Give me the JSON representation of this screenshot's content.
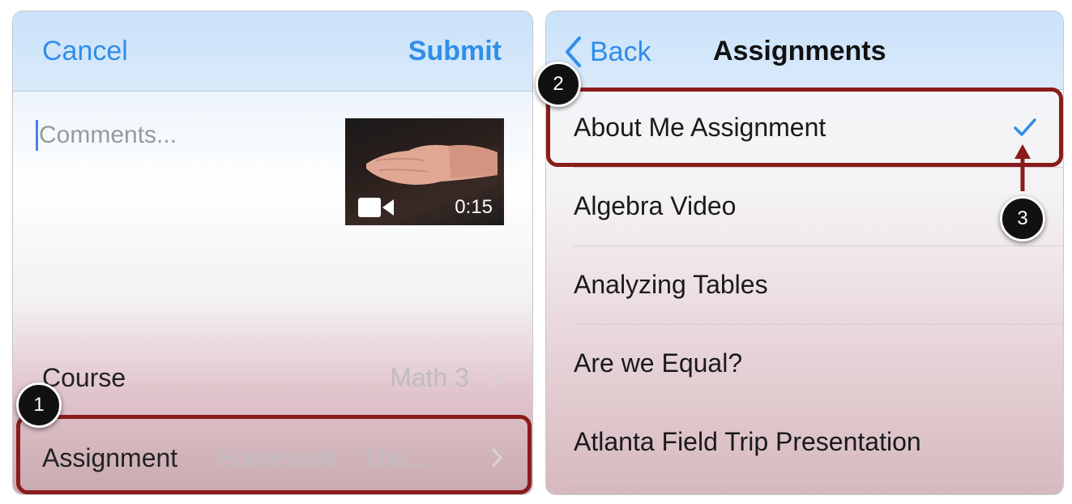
{
  "compose": {
    "cancel_label": "Cancel",
    "submit_label": "Submit",
    "comments_placeholder": "Comments...",
    "video": {
      "duration": "0:15"
    },
    "course": {
      "label": "Course",
      "value": "Math 3"
    },
    "assignment": {
      "label": "Assignment",
      "value": "Homework - The..."
    }
  },
  "assignments_list": {
    "back_label": "Back",
    "title": "Assignments",
    "items": [
      {
        "label": "About Me Assignment",
        "selected": true
      },
      {
        "label": "Algebra Video"
      },
      {
        "label": "Analyzing Tables"
      },
      {
        "label": "Are we Equal?"
      },
      {
        "label": "Atlanta Field Trip Presentation"
      }
    ]
  },
  "callouts": {
    "step1": "1",
    "step2": "2",
    "step3": "3"
  },
  "colors": {
    "ios_blue": "#2f8ee8",
    "callout_red": "#8a1c1c"
  }
}
